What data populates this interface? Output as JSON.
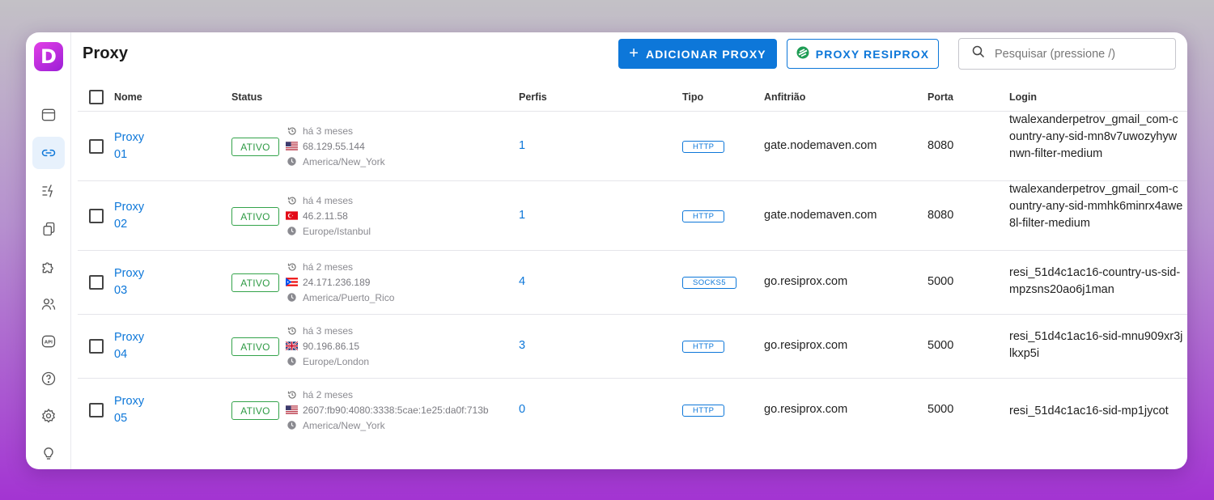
{
  "page": {
    "title": "Proxy"
  },
  "logo": {
    "letter": "D"
  },
  "actions": {
    "add_label": "ADICIONAR PROXY",
    "resiprox_label": "PROXY RESIPROX"
  },
  "search": {
    "placeholder": "Pesquisar (pressione /)"
  },
  "sidebar": {
    "items": [
      {
        "icon": "browser-window-icon"
      },
      {
        "icon": "link-icon",
        "active": true
      },
      {
        "icon": "automation-icon"
      },
      {
        "icon": "copy-icon"
      },
      {
        "icon": "puzzle-icon"
      },
      {
        "icon": "users-icon"
      },
      {
        "icon": "api-icon"
      },
      {
        "icon": "help-icon"
      },
      {
        "icon": "settings-icon"
      },
      {
        "icon": "lightbulb-icon"
      }
    ]
  },
  "table": {
    "columns": [
      "Nome",
      "Status",
      "Perfis",
      "Tipo",
      "Anfitrião",
      "Porta",
      "Login"
    ],
    "rows": [
      {
        "name_line1": "Proxy",
        "name_line2": "01",
        "status": "ATIVO",
        "last_check": "há 3 meses",
        "flag": "us",
        "ip": "68.129.55.144",
        "timezone": "America/New_York",
        "profiles": "1",
        "type": "HTTP",
        "host": "gate.nodemaven.com",
        "port": "8080",
        "login": "twalexanderpetrov_gmail_com-country-any-sid-mn8v7uwozyhywnwn-filter-medium"
      },
      {
        "name_line1": "Proxy",
        "name_line2": "02",
        "status": "ATIVO",
        "last_check": "há 4 meses",
        "flag": "tr",
        "ip": "46.2.11.58",
        "timezone": "Europe/Istanbul",
        "profiles": "1",
        "type": "HTTP",
        "host": "gate.nodemaven.com",
        "port": "8080",
        "login": "twalexanderpetrov_gmail_com-country-any-sid-mmhk6minrx4awe8l-filter-medium"
      },
      {
        "name_line1": "Proxy",
        "name_line2": "03",
        "status": "ATIVO",
        "last_check": "há 2 meses",
        "flag": "pr",
        "ip": "24.171.236.189",
        "timezone": "America/Puerto_Rico",
        "profiles": "4",
        "type": "SOCKS5",
        "host": "go.resiprox.com",
        "port": "5000",
        "login": "resi_51d4c1ac16-country-us-sid-mpzsns20ao6j1man"
      },
      {
        "name_line1": "Proxy",
        "name_line2": "04",
        "status": "ATIVO",
        "last_check": "há 3 meses",
        "flag": "gb",
        "ip": "90.196.86.15",
        "timezone": "Europe/London",
        "profiles": "3",
        "type": "HTTP",
        "host": "go.resiprox.com",
        "port": "5000",
        "login": "resi_51d4c1ac16-sid-mnu909xr3jlkxp5i"
      },
      {
        "name_line1": "Proxy",
        "name_line2": "05",
        "status": "ATIVO",
        "last_check": "há 2 meses",
        "flag": "us",
        "ip": "2607:fb90:4080:3338:5cae:1e25:da0f:713b",
        "timezone": "America/New_York",
        "profiles": "0",
        "type": "HTTP",
        "host": "go.resiprox.com",
        "port": "5000",
        "login": "resi_51d4c1ac16-sid-mp1jycot"
      }
    ]
  },
  "colors": {
    "accent": "#0d77d9",
    "status_green": "#2e9a44",
    "brand_gradient_start": "#e23ee6",
    "brand_gradient_end": "#9b1fd6"
  }
}
